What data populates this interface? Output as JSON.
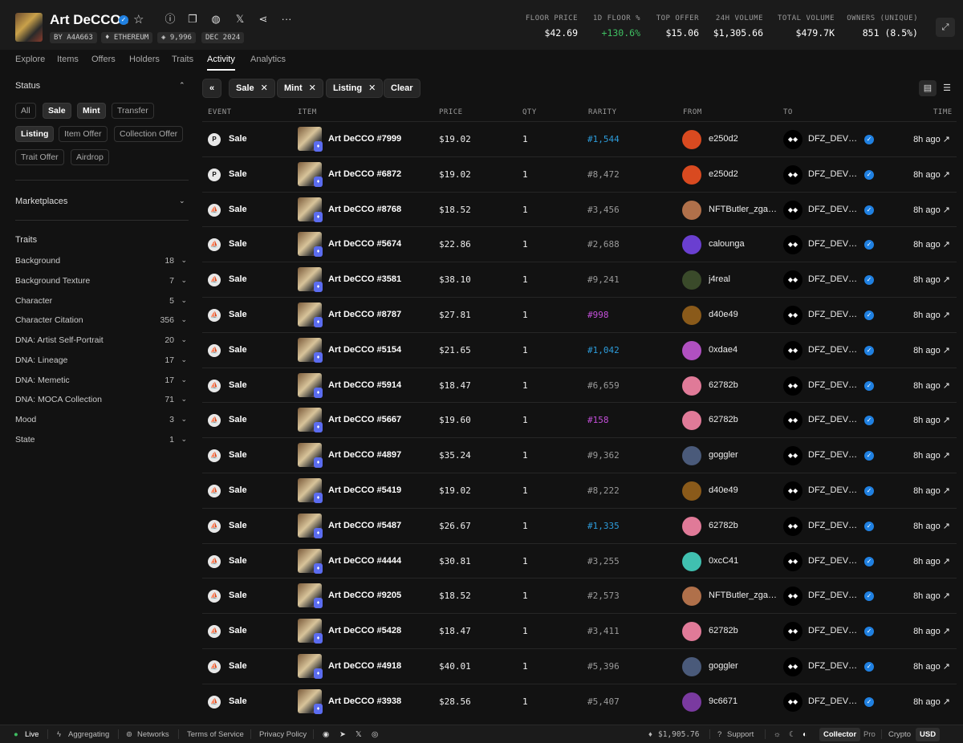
{
  "header": {
    "title": "Art DeCCOs",
    "chips": {
      "creator": "BY A4A663",
      "chain": "ETHEREUM",
      "supply": "9,996",
      "date": "DEC 2024"
    },
    "stats": [
      {
        "label": "FLOOR PRICE",
        "value": "$42.69"
      },
      {
        "label": "1D FLOOR %",
        "value": "+130.6%"
      },
      {
        "label": "TOP OFFER",
        "value": "$15.06"
      },
      {
        "label": "24H VOLUME",
        "value": "$1,305.66"
      },
      {
        "label": "TOTAL VOLUME",
        "value": "$479.7K"
      },
      {
        "label": "OWNERS (UNIQUE)",
        "value": "851 (8.5%)"
      }
    ],
    "colors": {
      "positive": "#3fbf62",
      "accent": "#2081e2"
    }
  },
  "tabs": [
    "Explore",
    "Items",
    "Offers",
    "Holders",
    "Traits",
    "Activity",
    "Analytics"
  ],
  "active_tab": "Activity",
  "sidebar": {
    "status_title": "Status",
    "status_chips": [
      "All",
      "Sale",
      "Mint",
      "Transfer",
      "Listing",
      "Item Offer",
      "Collection Offer",
      "Trait Offer",
      "Airdrop"
    ],
    "marketplaces_title": "Marketplaces",
    "traits_title": "Traits",
    "traits": [
      {
        "name": "Background",
        "count": "18"
      },
      {
        "name": "Background Texture",
        "count": "7"
      },
      {
        "name": "Character",
        "count": "5"
      },
      {
        "name": "Character Citation",
        "count": "356"
      },
      {
        "name": "DNA: Artist Self-Portrait",
        "count": "20"
      },
      {
        "name": "DNA: Lineage",
        "count": "17"
      },
      {
        "name": "DNA: Memetic",
        "count": "17"
      },
      {
        "name": "DNA: MOCA Collection",
        "count": "71"
      },
      {
        "name": "Mood",
        "count": "3"
      },
      {
        "name": "State",
        "count": "1"
      }
    ]
  },
  "toolbar": {
    "filters": [
      "Sale",
      "Mint",
      "Listing"
    ],
    "clear": "Clear"
  },
  "columns": {
    "event": "EVENT",
    "item": "ITEM",
    "price": "PRICE",
    "qty": "QTY",
    "rarity": "RARITY",
    "from": "FROM",
    "to": "TO",
    "time": "TIME"
  },
  "rarity_colors": {
    "default": "#9a9a9a",
    "blue": "#2d9cdb",
    "purple": "#c34fd9"
  },
  "rows": [
    {
      "event": "Sale",
      "icon": "opensea-pro-icon",
      "item": "Art DeCCO #7999",
      "price": "$19.02",
      "qty": "1",
      "rarity": "#1,544",
      "rarity_tier": "blue",
      "from": "e250d2",
      "from_color": "#d94a20",
      "to": "DFZ_DEVEL...",
      "time": "8h ago"
    },
    {
      "event": "Sale",
      "icon": "opensea-pro-icon",
      "item": "Art DeCCO #6872",
      "price": "$19.02",
      "qty": "1",
      "rarity": "#8,472",
      "rarity_tier": "default",
      "from": "e250d2",
      "from_color": "#d94a20",
      "to": "DFZ_DEVEL...",
      "time": "8h ago"
    },
    {
      "event": "Sale",
      "icon": "opensea-icon",
      "item": "Art DeCCO #8768",
      "price": "$18.52",
      "qty": "1",
      "rarity": "#3,456",
      "rarity_tier": "default",
      "from": "NFTButler_zgan...",
      "from_color": "#b0704a",
      "to": "DFZ_DEVEL...",
      "time": "8h ago"
    },
    {
      "event": "Sale",
      "icon": "opensea-icon",
      "item": "Art DeCCO #5674",
      "price": "$22.86",
      "qty": "1",
      "rarity": "#2,688",
      "rarity_tier": "default",
      "from": "calounga",
      "from_color": "#6a3fd0",
      "to": "DFZ_DEVEL...",
      "time": "8h ago"
    },
    {
      "event": "Sale",
      "icon": "opensea-icon",
      "item": "Art DeCCO #3581",
      "price": "$38.10",
      "qty": "1",
      "rarity": "#9,241",
      "rarity_tier": "default",
      "from": "j4real",
      "from_color": "#3a4a2a",
      "to": "DFZ_DEVEL...",
      "time": "8h ago"
    },
    {
      "event": "Sale",
      "icon": "opensea-icon",
      "item": "Art DeCCO #8787",
      "price": "$27.81",
      "qty": "1",
      "rarity": "#998",
      "rarity_tier": "purple",
      "from": "d40e49",
      "from_color": "#8a5a1a",
      "to": "DFZ_DEVEL...",
      "time": "8h ago"
    },
    {
      "event": "Sale",
      "icon": "opensea-icon",
      "item": "Art DeCCO #5154",
      "price": "$21.65",
      "qty": "1",
      "rarity": "#1,042",
      "rarity_tier": "blue",
      "from": "0xdae4",
      "from_color": "#b050c0",
      "to": "DFZ_DEVEL...",
      "time": "8h ago"
    },
    {
      "event": "Sale",
      "icon": "opensea-icon",
      "item": "Art DeCCO #5914",
      "price": "$18.47",
      "qty": "1",
      "rarity": "#6,659",
      "rarity_tier": "default",
      "from": "62782b",
      "from_color": "#e07a98",
      "to": "DFZ_DEVEL...",
      "time": "8h ago"
    },
    {
      "event": "Sale",
      "icon": "opensea-icon",
      "item": "Art DeCCO #5667",
      "price": "$19.60",
      "qty": "1",
      "rarity": "#158",
      "rarity_tier": "purple",
      "from": "62782b",
      "from_color": "#e07a98",
      "to": "DFZ_DEVEL...",
      "time": "8h ago"
    },
    {
      "event": "Sale",
      "icon": "opensea-icon",
      "item": "Art DeCCO #4897",
      "price": "$35.24",
      "qty": "1",
      "rarity": "#9,362",
      "rarity_tier": "default",
      "from": "goggler",
      "from_color": "#4a5a7a",
      "to": "DFZ_DEVEL...",
      "time": "8h ago"
    },
    {
      "event": "Sale",
      "icon": "opensea-icon",
      "item": "Art DeCCO #5419",
      "price": "$19.02",
      "qty": "1",
      "rarity": "#8,222",
      "rarity_tier": "default",
      "from": "d40e49",
      "from_color": "#8a5a1a",
      "to": "DFZ_DEVEL...",
      "time": "8h ago"
    },
    {
      "event": "Sale",
      "icon": "opensea-icon",
      "item": "Art DeCCO #5487",
      "price": "$26.67",
      "qty": "1",
      "rarity": "#1,335",
      "rarity_tier": "blue",
      "from": "62782b",
      "from_color": "#e07a98",
      "to": "DFZ_DEVEL...",
      "time": "8h ago"
    },
    {
      "event": "Sale",
      "icon": "opensea-icon",
      "item": "Art DeCCO #4444",
      "price": "$30.81",
      "qty": "1",
      "rarity": "#3,255",
      "rarity_tier": "default",
      "from": "0xcC41",
      "from_color": "#40c0b0",
      "to": "DFZ_DEVEL...",
      "time": "8h ago"
    },
    {
      "event": "Sale",
      "icon": "opensea-icon",
      "item": "Art DeCCO #9205",
      "price": "$18.52",
      "qty": "1",
      "rarity": "#2,573",
      "rarity_tier": "default",
      "from": "NFTButler_zgan...",
      "from_color": "#b0704a",
      "to": "DFZ_DEVEL...",
      "time": "8h ago"
    },
    {
      "event": "Sale",
      "icon": "opensea-icon",
      "item": "Art DeCCO #5428",
      "price": "$18.47",
      "qty": "1",
      "rarity": "#3,411",
      "rarity_tier": "default",
      "from": "62782b",
      "from_color": "#e07a98",
      "to": "DFZ_DEVEL...",
      "time": "8h ago"
    },
    {
      "event": "Sale",
      "icon": "opensea-icon",
      "item": "Art DeCCO #4918",
      "price": "$40.01",
      "qty": "1",
      "rarity": "#5,396",
      "rarity_tier": "default",
      "from": "goggler",
      "from_color": "#4a5a7a",
      "to": "DFZ_DEVEL...",
      "time": "8h ago"
    },
    {
      "event": "Sale",
      "icon": "opensea-icon",
      "item": "Art DeCCO #3938",
      "price": "$28.56",
      "qty": "1",
      "rarity": "#5,407",
      "rarity_tier": "default",
      "from": "9c6671",
      "from_color": "#7a3aa0",
      "to": "DFZ_DEVEL...",
      "time": "8h ago"
    }
  ],
  "footer": {
    "live": "Live",
    "aggregating": "Aggregating",
    "networks": "Networks",
    "terms": "Terms of Service",
    "privacy": "Privacy Policy",
    "eth_price": "$1,905.76",
    "support": "Support",
    "mode_collector": "Collector",
    "mode_pro": "Pro",
    "currency_crypto": "Crypto",
    "currency_usd": "USD"
  }
}
